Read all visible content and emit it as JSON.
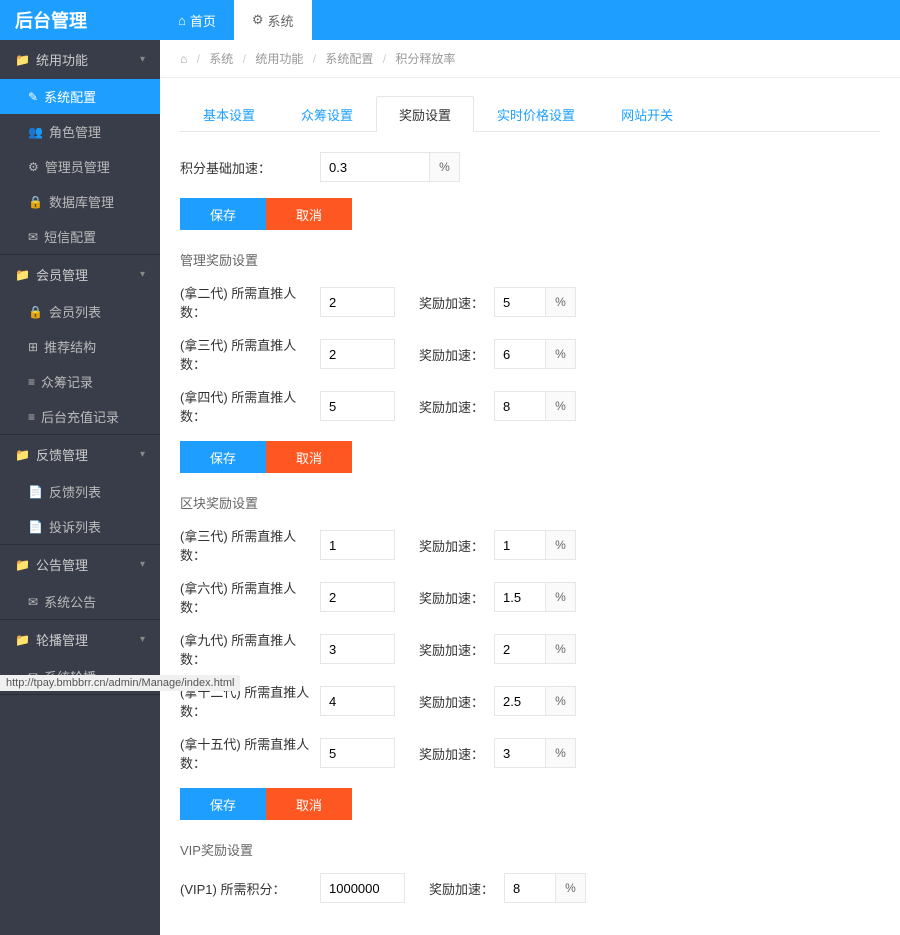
{
  "header": {
    "logo": "后台管理",
    "nav": [
      {
        "label": "首页",
        "icon": "⌂"
      },
      {
        "label": "系统",
        "icon": "⚙"
      }
    ]
  },
  "sidebar": {
    "groups": [
      {
        "title": "统用功能",
        "icon": "📁",
        "items": [
          {
            "label": "系统配置",
            "icon": "✎",
            "active": true
          },
          {
            "label": "角色管理",
            "icon": "👥"
          },
          {
            "label": "管理员管理",
            "icon": "⚙"
          },
          {
            "label": "数据库管理",
            "icon": "🔒"
          },
          {
            "label": "短信配置",
            "icon": "✉"
          }
        ]
      },
      {
        "title": "会员管理",
        "icon": "📁",
        "items": [
          {
            "label": "会员列表",
            "icon": "🔒"
          },
          {
            "label": "推荐结构",
            "icon": "⊞"
          },
          {
            "label": "众筹记录",
            "icon": "≡"
          },
          {
            "label": "后台充值记录",
            "icon": "≡"
          }
        ]
      },
      {
        "title": "反馈管理",
        "icon": "📁",
        "items": [
          {
            "label": "反馈列表",
            "icon": "📄"
          },
          {
            "label": "投诉列表",
            "icon": "📄"
          }
        ]
      },
      {
        "title": "公告管理",
        "icon": "📁",
        "items": [
          {
            "label": "系统公告",
            "icon": "✉"
          }
        ]
      },
      {
        "title": "轮播管理",
        "icon": "📁",
        "items": [
          {
            "label": "系统轮播",
            "icon": "✉"
          }
        ]
      }
    ]
  },
  "breadcrumb": {
    "home_icon": "⌂",
    "items": [
      "系统",
      "统用功能",
      "系统配置",
      "积分释放率"
    ]
  },
  "tabs": [
    {
      "label": "基本设置"
    },
    {
      "label": "众筹设置"
    },
    {
      "label": "奖励设置",
      "active": true
    },
    {
      "label": "实时价格设置"
    },
    {
      "label": "网站开关"
    }
  ],
  "base": {
    "label": "积分基础加速：",
    "value": "0.3",
    "unit": "%"
  },
  "buttons": {
    "save": "保存",
    "cancel": "取消"
  },
  "section1": {
    "title": "管理奖励设置",
    "rows": [
      {
        "lbl1": "(拿二代) 所需直推人数：",
        "v1": "2",
        "lbl2": "奖励加速：",
        "v2": "5",
        "unit": "%"
      },
      {
        "lbl1": "(拿三代) 所需直推人数：",
        "v1": "2",
        "lbl2": "奖励加速：",
        "v2": "6",
        "unit": "%"
      },
      {
        "lbl1": "(拿四代) 所需直推人数：",
        "v1": "5",
        "lbl2": "奖励加速：",
        "v2": "8",
        "unit": "%"
      }
    ]
  },
  "section2": {
    "title": "区块奖励设置",
    "rows": [
      {
        "lbl1": "(拿三代) 所需直推人数：",
        "v1": "1",
        "lbl2": "奖励加速：",
        "v2": "1",
        "unit": "%"
      },
      {
        "lbl1": "(拿六代) 所需直推人数：",
        "v1": "2",
        "lbl2": "奖励加速：",
        "v2": "1.5",
        "unit": "%"
      },
      {
        "lbl1": "(拿九代) 所需直推人数：",
        "v1": "3",
        "lbl2": "奖励加速：",
        "v2": "2",
        "unit": "%"
      },
      {
        "lbl1": "(拿十二代) 所需直推人数：",
        "v1": "4",
        "lbl2": "奖励加速：",
        "v2": "2.5",
        "unit": "%"
      },
      {
        "lbl1": "(拿十五代) 所需直推人数：",
        "v1": "5",
        "lbl2": "奖励加速：",
        "v2": "3",
        "unit": "%"
      }
    ]
  },
  "section3": {
    "title": "VIP奖励设置",
    "rows": [
      {
        "lbl1": "(VIP1) 所需积分：",
        "v1": "1000000",
        "lbl2": "奖励加速：",
        "v2": "8",
        "unit": "%"
      }
    ]
  },
  "status_url": "http://tpay.bmbbrr.cn/admin/Manage/index.html"
}
